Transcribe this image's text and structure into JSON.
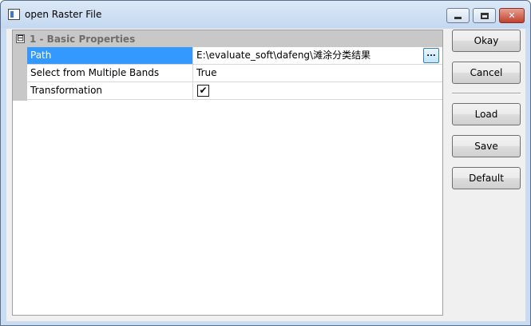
{
  "window": {
    "title": "open Raster File"
  },
  "grid": {
    "category": {
      "expander": "⊟",
      "label": "1 - Basic Properties"
    },
    "rows": [
      {
        "name": "Path",
        "value": "E:\\evaluate_soft\\dafeng\\滩涂分类结果",
        "button": "..."
      },
      {
        "name": "Select from Multiple Bands",
        "value": "True"
      },
      {
        "name": "Transformation",
        "checked_glyph": "✔"
      }
    ]
  },
  "buttons": {
    "okay": "Okay",
    "cancel": "Cancel",
    "load": "Load",
    "save": "Save",
    "default": "Default"
  },
  "colors": {
    "selection": "#3399ff",
    "category_bg": "#c8c8c8",
    "frame": "#c9dcf2"
  }
}
